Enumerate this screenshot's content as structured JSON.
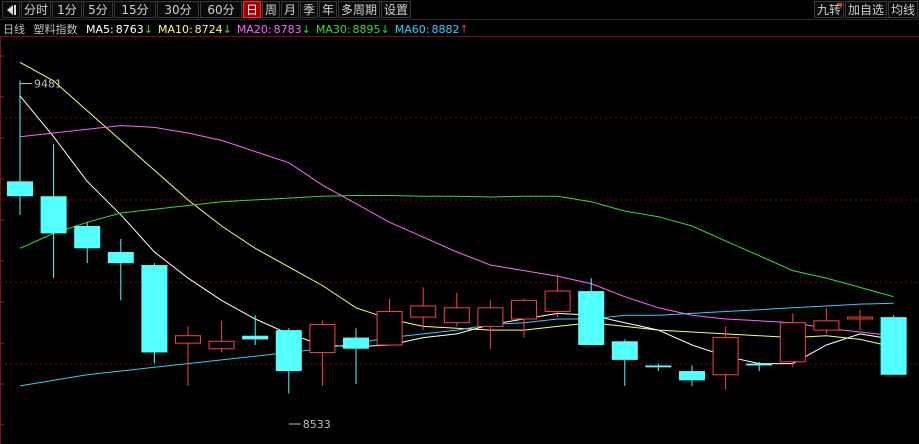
{
  "toolbar": {
    "left_items": [
      {
        "label": "分时",
        "active": false
      },
      {
        "label": "1分",
        "active": false
      },
      {
        "label": "5分",
        "active": false
      },
      {
        "label": "15分",
        "active": false
      },
      {
        "label": "30分",
        "active": false
      },
      {
        "label": "60分",
        "active": false
      },
      {
        "label": "日",
        "active": true
      },
      {
        "label": "周",
        "active": false
      },
      {
        "label": "月",
        "active": false
      },
      {
        "label": "季",
        "active": false
      },
      {
        "label": "年",
        "active": false
      },
      {
        "label": "多周期",
        "active": false
      },
      {
        "label": "设置",
        "active": false
      }
    ],
    "right_items": [
      {
        "label": "九转"
      },
      {
        "label": "加自选"
      },
      {
        "label": "均线"
      }
    ],
    "back_icon": "back-arrow-icon"
  },
  "indicators": {
    "period": "日线",
    "name": "塑料指数",
    "ma5": {
      "label": "MA5:",
      "value": "8763",
      "arrow": "↓",
      "color": "#ffffff"
    },
    "ma10": {
      "label": "MA10:",
      "value": "8724",
      "arrow": "↓",
      "color": "#ffff66"
    },
    "ma20": {
      "label": "MA20:",
      "value": "8783",
      "arrow": "↓",
      "color": "#ff66ff"
    },
    "ma30": {
      "label": "MA30:",
      "value": "8895",
      "arrow": "↓",
      "color": "#33dd33"
    },
    "ma60": {
      "label": "MA60:",
      "value": "8882",
      "arrow": "↑",
      "color": "#33ccff"
    },
    "down_arrow_color": "#33dd33",
    "up_arrow_color": "#ff3333"
  },
  "chart_data": {
    "type": "candlestick",
    "ylim": [
      8520,
      9590
    ],
    "grid": true,
    "candles": [
      {
        "o": 9210,
        "h": 9481,
        "l": 9120,
        "c": 9170
      },
      {
        "o": 9170,
        "h": 9310,
        "l": 8950,
        "c": 9070
      },
      {
        "o": 9090,
        "h": 9100,
        "l": 8990,
        "c": 9030
      },
      {
        "o": 9020,
        "h": 9055,
        "l": 8890,
        "c": 8990
      },
      {
        "o": 8985,
        "h": 8990,
        "l": 8720,
        "c": 8750
      },
      {
        "o": 8775,
        "h": 8820,
        "l": 8660,
        "c": 8795
      },
      {
        "o": 8760,
        "h": 8835,
        "l": 8750,
        "c": 8780
      },
      {
        "o": 8795,
        "h": 8850,
        "l": 8770,
        "c": 8785
      },
      {
        "o": 8810,
        "h": 8815,
        "l": 8640,
        "c": 8700
      },
      {
        "o": 8750,
        "h": 8835,
        "l": 8660,
        "c": 8825
      },
      {
        "o": 8790,
        "h": 8815,
        "l": 8665,
        "c": 8760
      },
      {
        "o": 8770,
        "h": 8895,
        "l": 8770,
        "c": 8860
      },
      {
        "o": 8845,
        "h": 8925,
        "l": 8810,
        "c": 8875
      },
      {
        "o": 8830,
        "h": 8910,
        "l": 8820,
        "c": 8870
      },
      {
        "o": 8820,
        "h": 8890,
        "l": 8760,
        "c": 8870
      },
      {
        "o": 8840,
        "h": 8895,
        "l": 8790,
        "c": 8890
      },
      {
        "o": 8860,
        "h": 8960,
        "l": 8845,
        "c": 8915
      },
      {
        "o": 8915,
        "h": 8950,
        "l": 8780,
        "c": 8770
      },
      {
        "o": 8780,
        "h": 8785,
        "l": 8660,
        "c": 8730
      },
      {
        "o": 8715,
        "h": 8720,
        "l": 8700,
        "c": 8710
      },
      {
        "o": 8700,
        "h": 8715,
        "l": 8660,
        "c": 8675
      },
      {
        "o": 8690,
        "h": 8820,
        "l": 8650,
        "c": 8790
      },
      {
        "o": 8720,
        "h": 8725,
        "l": 8700,
        "c": 8715
      },
      {
        "o": 8725,
        "h": 8855,
        "l": 8710,
        "c": 8830
      },
      {
        "o": 8810,
        "h": 8870,
        "l": 8800,
        "c": 8835
      },
      {
        "o": 8840,
        "h": 8865,
        "l": 8810,
        "c": 8845
      },
      {
        "o": 8845,
        "h": 8850,
        "l": 8690,
        "c": 8690
      }
    ],
    "max_label": "9481",
    "min_label": "8533",
    "series": [
      {
        "name": "MA5",
        "color": "#ffffff",
        "values": [
          9440,
          9330,
          9210,
          9120,
          9020,
          8950,
          8890,
          8840,
          8800,
          8770,
          8765,
          8770,
          8790,
          8800,
          8825,
          8840,
          8855,
          8850,
          8830,
          8810,
          8770,
          8740,
          8720,
          8720,
          8770,
          8800,
          8785
        ]
      },
      {
        "name": "MA10",
        "color": "#ffff66",
        "values": [
          9530,
          9480,
          9400,
          9320,
          9240,
          9160,
          9090,
          9030,
          8980,
          8930,
          8870,
          8840,
          8820,
          8815,
          8810,
          8810,
          8820,
          8830,
          8820,
          8810,
          8805,
          8800,
          8795,
          8790,
          8795,
          8785,
          8765
        ]
      },
      {
        "name": "MA20",
        "color": "#ff66ff",
        "values": [
          9330,
          9340,
          9350,
          9360,
          9355,
          9340,
          9320,
          9290,
          9260,
          9200,
          9150,
          9100,
          9060,
          9020,
          8985,
          8970,
          8955,
          8935,
          8900,
          8870,
          8850,
          8840,
          8835,
          8830,
          8815,
          8805,
          8795
        ]
      },
      {
        "name": "MA30",
        "color": "#33dd33",
        "values": [
          9030,
          9070,
          9100,
          9125,
          9135,
          9145,
          9155,
          9160,
          9165,
          9170,
          9172,
          9172,
          9170,
          9170,
          9168,
          9170,
          9170,
          9155,
          9130,
          9115,
          9090,
          9050,
          9010,
          8970,
          8950,
          8925,
          8900
        ]
      },
      {
        "name": "MA60",
        "color": "#33ccff",
        "values": [
          8660,
          8675,
          8690,
          8700,
          8710,
          8720,
          8730,
          8740,
          8750,
          8760,
          8775,
          8790,
          8800,
          8810,
          8825,
          8830,
          8840,
          8840,
          8850,
          8850,
          8855,
          8860,
          8865,
          8870,
          8875,
          8880,
          8882
        ]
      }
    ]
  }
}
